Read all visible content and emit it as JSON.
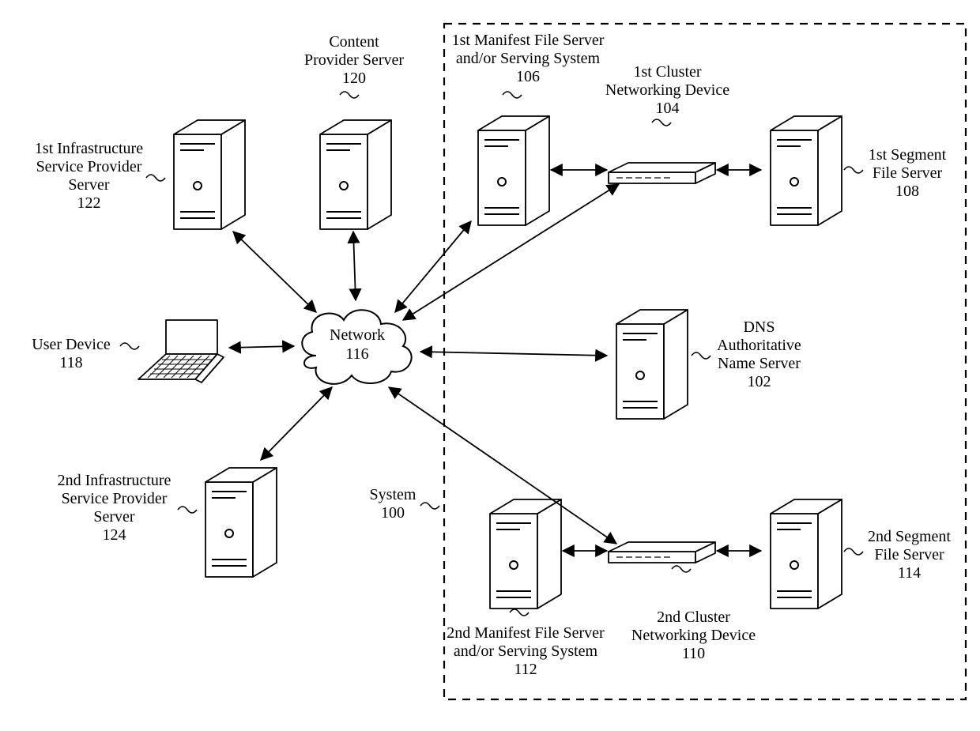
{
  "network": {
    "label_line1": "Network",
    "label_line2": "116"
  },
  "system": {
    "label_line1": "System",
    "label_line2": "100"
  },
  "nodes": {
    "infra1": {
      "l1": "1st Infrastructure",
      "l2": "Service Provider",
      "l3": "Server",
      "l4": "122"
    },
    "content_provider": {
      "l1": "Content",
      "l2": "Provider Server",
      "l3": "120"
    },
    "user_device": {
      "l1": "User Device",
      "l2": "118"
    },
    "infra2": {
      "l1": "2nd Infrastructure",
      "l2": "Service Provider",
      "l3": "Server",
      "l4": "124"
    },
    "manifest1": {
      "l1": "1st Manifest File Server",
      "l2": "and/or Serving System",
      "l3": "106"
    },
    "cluster1": {
      "l1": "1st Cluster",
      "l2": "Networking Device",
      "l3": "104"
    },
    "segment1": {
      "l1": "1st Segment",
      "l2": "File Server",
      "l3": "108"
    },
    "dns": {
      "l1": "DNS",
      "l2": "Authoritative",
      "l3": "Name Server",
      "l4": "102"
    },
    "manifest2": {
      "l1": "2nd Manifest File Server",
      "l2": "and/or Serving System",
      "l3": "112"
    },
    "cluster2": {
      "l1": "2nd Cluster",
      "l2": "Networking Device",
      "l3": "110"
    },
    "segment2": {
      "l1": "2nd Segment",
      "l2": "File Server",
      "l3": "114"
    }
  }
}
